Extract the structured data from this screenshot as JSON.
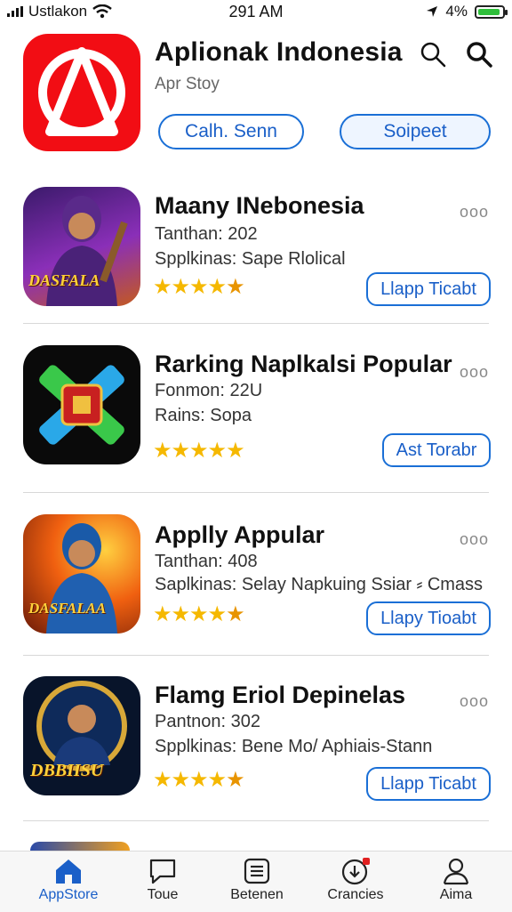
{
  "status_bar": {
    "carrier": "Ustlakon",
    "time": "291 AM",
    "battery": "4%",
    "battery_color": "#2fbf3b"
  },
  "header": {
    "title": "Aplionak Indonesia",
    "subtitle": "Apr Stoy",
    "icon": "red-triangle-logo-icon",
    "icon_color": "#f20d14",
    "button_1": "Calh. Senn",
    "button_2": "Soipeet"
  },
  "apps": [
    {
      "title": "Maany INebonesia",
      "line1": "Tanthan: 202",
      "line2": "Spplkinas: Sape Rlolical",
      "rating": 4.5,
      "action": "Llapp Ticabt",
      "thumb_text": "DASFALA"
    },
    {
      "title": "Rarking Naplkalsi Popular",
      "line1": "Fonmon: 22U",
      "line2": "Rains: Sopa",
      "rating": 5,
      "action": "Ast Torabr",
      "thumb_text": ""
    },
    {
      "title": "Applly Appular",
      "line1": "Tanthan: 408",
      "line2": "Saplkinas: Selay Napkuing Ssiar ⸗ Cmass",
      "rating": 4.5,
      "action": "Llapy Tioabt",
      "thumb_text": "DASFALAA"
    },
    {
      "title": "Flamg Eriol Depinelas",
      "line1": "Pantnon: 302",
      "line2": "Spplkinas: Bene Mo/ Aphiais-Stann",
      "rating": 4.5,
      "action": "Llapp Ticabt",
      "thumb_text": "DBBIISU"
    }
  ],
  "more_label": "ooo",
  "tabs": [
    {
      "label": "AppStore",
      "icon": "home-icon",
      "active": true
    },
    {
      "label": "Toue",
      "icon": "chat-icon"
    },
    {
      "label": "Betenen",
      "icon": "list-icon"
    },
    {
      "label": "Crancies",
      "icon": "download-icon"
    },
    {
      "label": "Aima",
      "icon": "person-icon"
    }
  ],
  "accent_color": "#1a6fd6"
}
